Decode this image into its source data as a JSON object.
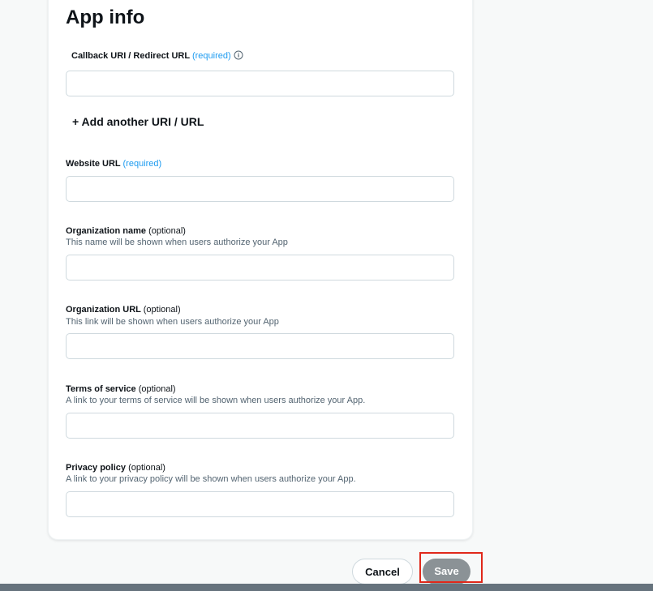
{
  "page": {
    "title": "App info"
  },
  "callback": {
    "label": "Callback URI / Redirect URL",
    "required": "(required)",
    "info_icon": "info-icon",
    "value": "",
    "add_another": "+ Add another URI / URL"
  },
  "website": {
    "label": "Website URL",
    "required": "(required)",
    "value": ""
  },
  "organization_name": {
    "label": "Organization name",
    "optional": "(optional)",
    "help": "This name will be shown when users authorize your App",
    "value": ""
  },
  "organization_url": {
    "label": "Organization URL",
    "optional": "(optional)",
    "help": "This link will be shown when users authorize your App",
    "value": ""
  },
  "terms": {
    "label": "Terms of service",
    "optional": "(optional)",
    "help": "A link to your terms of service will be shown when users authorize your App.",
    "value": ""
  },
  "privacy": {
    "label": "Privacy policy",
    "optional": "(optional)",
    "help": "A link to your privacy policy will be shown when users authorize your App.",
    "value": ""
  },
  "actions": {
    "cancel": "Cancel",
    "save": "Save"
  },
  "colors": {
    "accent": "#1d9bf0",
    "save_disabled": "#8b9296",
    "highlight": "#e0281a",
    "page_background": "#f7f9f9"
  }
}
